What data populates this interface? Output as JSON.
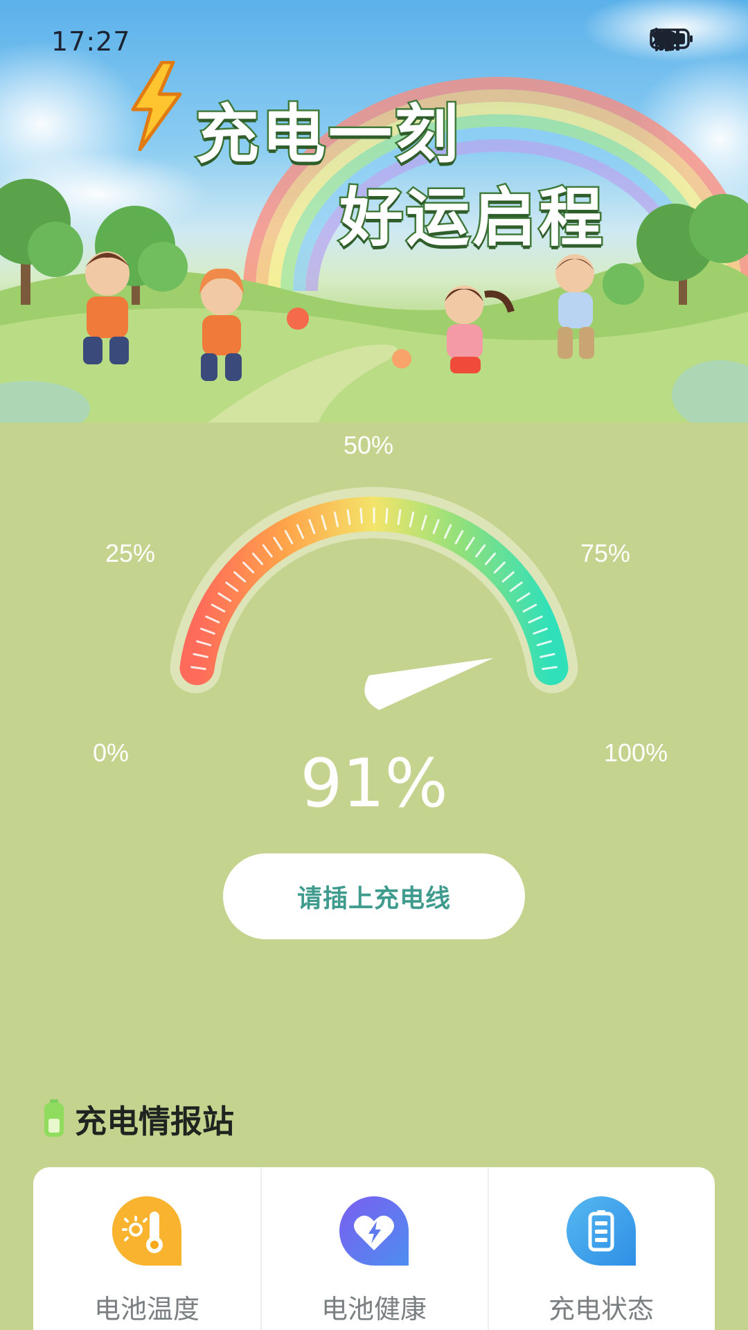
{
  "status_bar": {
    "time": "17:27",
    "icons": [
      "bluetooth-icon",
      "mute-bell-icon",
      "wifi-icon",
      "signal-5g-icon",
      "battery-icon"
    ]
  },
  "hero": {
    "title_line_1": "充电一刻",
    "title_line_2": "好运启程",
    "icon": "lightning-bolt-icon"
  },
  "gauge": {
    "labels": {
      "zero": "0%",
      "q1": "25%",
      "half": "50%",
      "q3": "75%",
      "full": "100%"
    },
    "value_text": "91%",
    "value_percent": 91,
    "colors": [
      "#ff6b5a",
      "#ffb347",
      "#f5e36a",
      "#9be07a",
      "#36e0b5"
    ]
  },
  "plug_button": {
    "label": "请插上充电线"
  },
  "info": {
    "section_title": "充电情报站",
    "section_icon": "battery-small-icon",
    "items": [
      {
        "label": "电池温度",
        "icon": "thermometer-icon",
        "color": "#f7a81b"
      },
      {
        "label": "电池健康",
        "icon": "heart-bolt-icon",
        "color": "#6a6fe6"
      },
      {
        "label": "充电状态",
        "icon": "battery-status-icon",
        "color": "#3fa3ea"
      }
    ]
  }
}
